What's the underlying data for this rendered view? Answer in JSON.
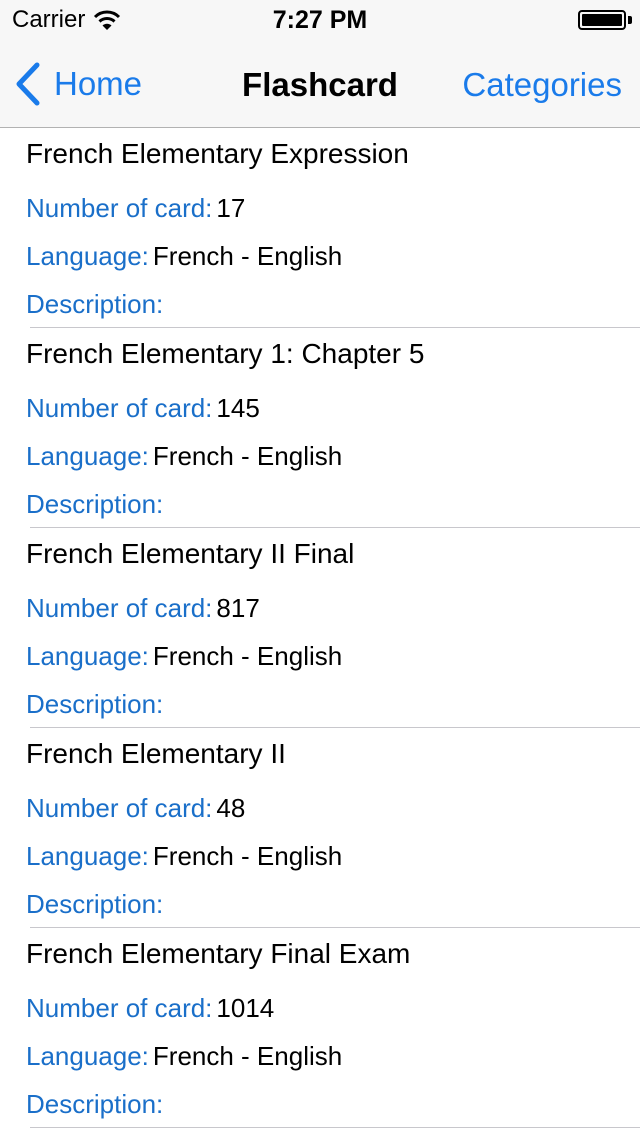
{
  "status_bar": {
    "carrier": "Carrier",
    "time": "7:27 PM"
  },
  "nav": {
    "back_label": "Home",
    "title": "Flashcard",
    "right_label": "Categories"
  },
  "labels": {
    "number_of_card": "Number of card:",
    "language": "Language:",
    "description": "Description:"
  },
  "decks": [
    {
      "title": "French Elementary Expression",
      "count": "17",
      "language": "French - English",
      "description": ""
    },
    {
      "title": "French Elementary 1: Chapter 5",
      "count": "145",
      "language": "French - English",
      "description": ""
    },
    {
      "title": "French Elementary II Final",
      "count": "817",
      "language": "French - English",
      "description": ""
    },
    {
      "title": "French Elementary II",
      "count": "48",
      "language": "French - English",
      "description": ""
    },
    {
      "title": "French Elementary Final Exam",
      "count": "1014",
      "language": "French - English",
      "description": ""
    }
  ],
  "colors": {
    "tint": "#1a7bea",
    "label_blue": "#1a6fc9",
    "bar_background": "#f7f7f7",
    "separator": "#c8c7cc"
  }
}
